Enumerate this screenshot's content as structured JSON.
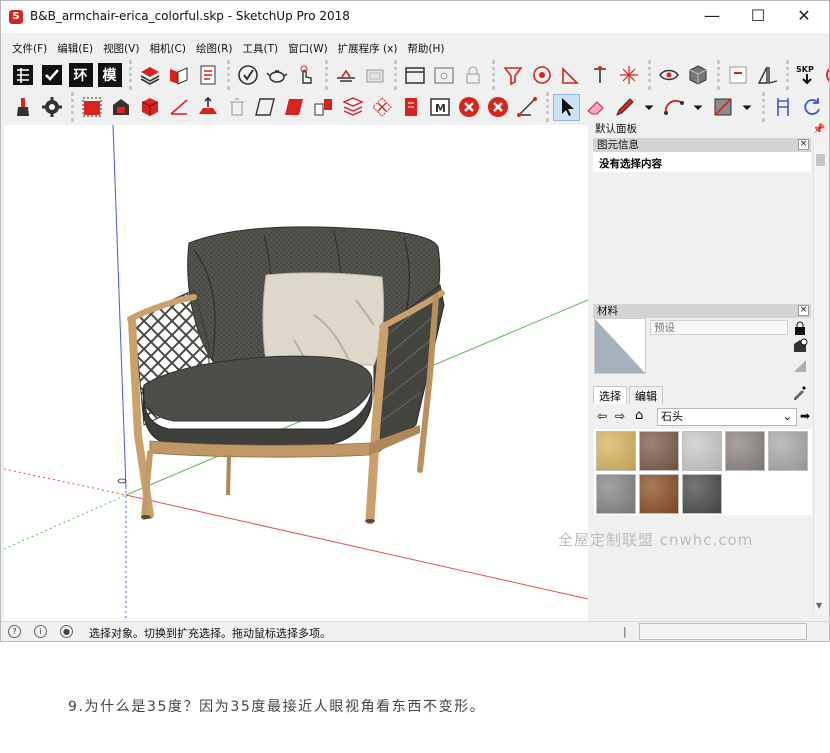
{
  "window": {
    "title": "B&B_armchair-erica_colorful.skp - SketchUp Pro 2018",
    "app_icon": "sketchup-logo-icon",
    "minimize": "—",
    "maximize": "☐",
    "close": "✕"
  },
  "menu": [
    "文件(F)",
    "编辑(E)",
    "视图(V)",
    "相机(C)",
    "绘图(R)",
    "工具(T)",
    "窗口(W)",
    "扩展程序 (x)",
    "帮助(H)"
  ],
  "toolbar1_text_buttons": [
    "环",
    "模"
  ],
  "toolbar1_skp_label": "SKP",
  "panel": {
    "tray_title": "默认面板",
    "entity_info_title": "图元信息",
    "entity_info_value": "没有选择内容",
    "materials_title": "材料",
    "material_name_placeholder": "预设",
    "tab_select": "选择",
    "tab_edit": "编辑",
    "library": "石头",
    "swatch_colors": [
      "#d9b45e",
      "#7c5a4a",
      "#c9c9c9",
      "#8c8480",
      "#a9a9a9",
      "#858585",
      "#8a4e23",
      "#4a4a4a"
    ]
  },
  "status": {
    "text": "选择对象。切换到扩充选择。拖动鼠标选择多项。",
    "measurement_label": "|"
  },
  "watermark": "全屋定制联盟 cnwhc.com",
  "caption": "9.为什么是35度？因为35度最接近人眼视角看东西不变形。",
  "colors": {
    "accent_red": "#d8231f",
    "panel_gray": "#f0f0f0",
    "axis_red": "#e05050",
    "axis_green": "#5ab85a",
    "axis_blue": "#4a5ad8"
  }
}
